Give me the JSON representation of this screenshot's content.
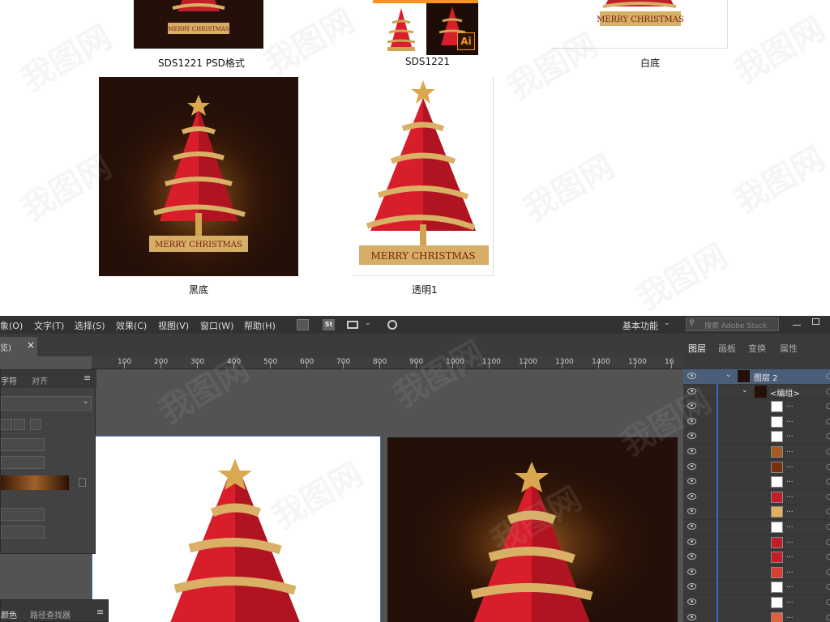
{
  "files": [
    {
      "label": "SDS1221 PSD格式"
    },
    {
      "label": "SDS1221"
    },
    {
      "label": "白底"
    },
    {
      "label": "黑底"
    },
    {
      "label": "透明1"
    }
  ],
  "artwork": {
    "banner_text": "MERRY CHRISTMAS",
    "ai_badge": "Ai"
  },
  "menubar": {
    "items": [
      "象(O)",
      "文字(T)",
      "选择(S)",
      "效果(C)",
      "视图(V)",
      "窗口(W)",
      "帮助(H)"
    ],
    "st_label": "St",
    "workspace": "基本功能",
    "search_placeholder": "搜索 Adobe Stock"
  },
  "document_tab": {
    "label": "览)",
    "close": "×"
  },
  "left_panel": {
    "tabs": [
      "字符",
      "对齐"
    ],
    "menu": "≡"
  },
  "left_panel2": {
    "tabs": [
      "颜色",
      "路径查找器"
    ]
  },
  "ruler": {
    "labels": [
      "100",
      "200",
      "300",
      "400",
      "500",
      "600",
      "700",
      "800",
      "900",
      "1000",
      "1100",
      "1200",
      "1300",
      "1400",
      "1500",
      "16"
    ]
  },
  "layers_panel": {
    "tabs": [
      "图层",
      "画板",
      "变换",
      "属性"
    ],
    "top_layer": "图层 2",
    "group_label": "<编组>",
    "item_dots": "...",
    "circle": "○"
  },
  "watermark": "我图网",
  "colors": {
    "app_bg": "#535353",
    "menubar_bg": "#323232",
    "panel_bg": "#3a3a3a",
    "tree_red": "#d91e2b",
    "ribbon_gold": "#cfa452",
    "dark_bg": "#241008"
  }
}
